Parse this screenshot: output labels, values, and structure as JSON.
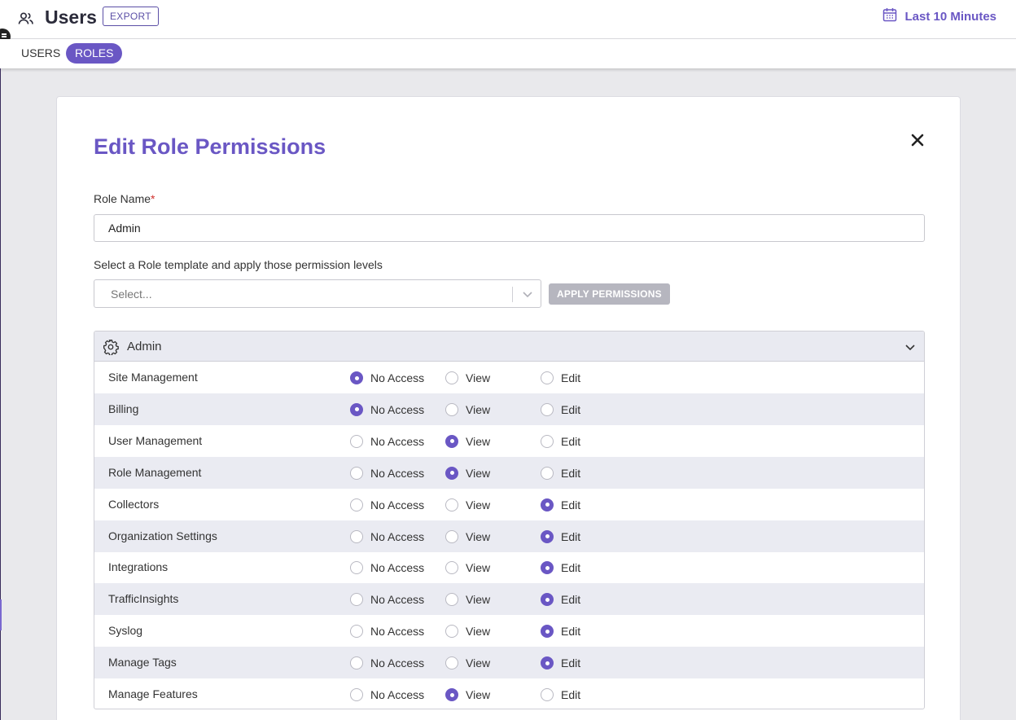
{
  "header": {
    "title": "Users",
    "export_label": "EXPORT",
    "time_range_label": "Last 10 Minutes"
  },
  "tabs": [
    {
      "label": "USERS",
      "active": false
    },
    {
      "label": "ROLES",
      "active": true
    }
  ],
  "modal": {
    "title": "Edit Role Permissions",
    "role_name_label": "Role Name",
    "required_mark": "*",
    "role_name_value": "Admin",
    "template_label": "Select a Role template and apply those permission levels",
    "template_placeholder": "Select...",
    "apply_label": "APPLY PERMISSIONS",
    "section_title": "Admin",
    "options": [
      "No Access",
      "View",
      "Edit"
    ],
    "permissions": [
      {
        "name": "Site Management",
        "selected": "No Access"
      },
      {
        "name": "Billing",
        "selected": "No Access"
      },
      {
        "name": "User Management",
        "selected": "View"
      },
      {
        "name": "Role Management",
        "selected": "View"
      },
      {
        "name": "Collectors",
        "selected": "Edit"
      },
      {
        "name": "Organization Settings",
        "selected": "Edit"
      },
      {
        "name": "Integrations",
        "selected": "Edit"
      },
      {
        "name": "TrafficInsights",
        "selected": "Edit"
      },
      {
        "name": "Syslog",
        "selected": "Edit"
      },
      {
        "name": "Manage Tags",
        "selected": "Edit"
      },
      {
        "name": "Manage Features",
        "selected": "View"
      }
    ]
  },
  "colors": {
    "accent": "#6a57c4",
    "row_alt": "#eaebf2",
    "required": "#d0312d"
  },
  "icons": {
    "header": "users-icon",
    "time": "calendar-icon",
    "close": "close-icon",
    "section": "gear-icon",
    "section_toggle": "chevron-down-icon",
    "select_toggle": "chevron-down-icon"
  }
}
